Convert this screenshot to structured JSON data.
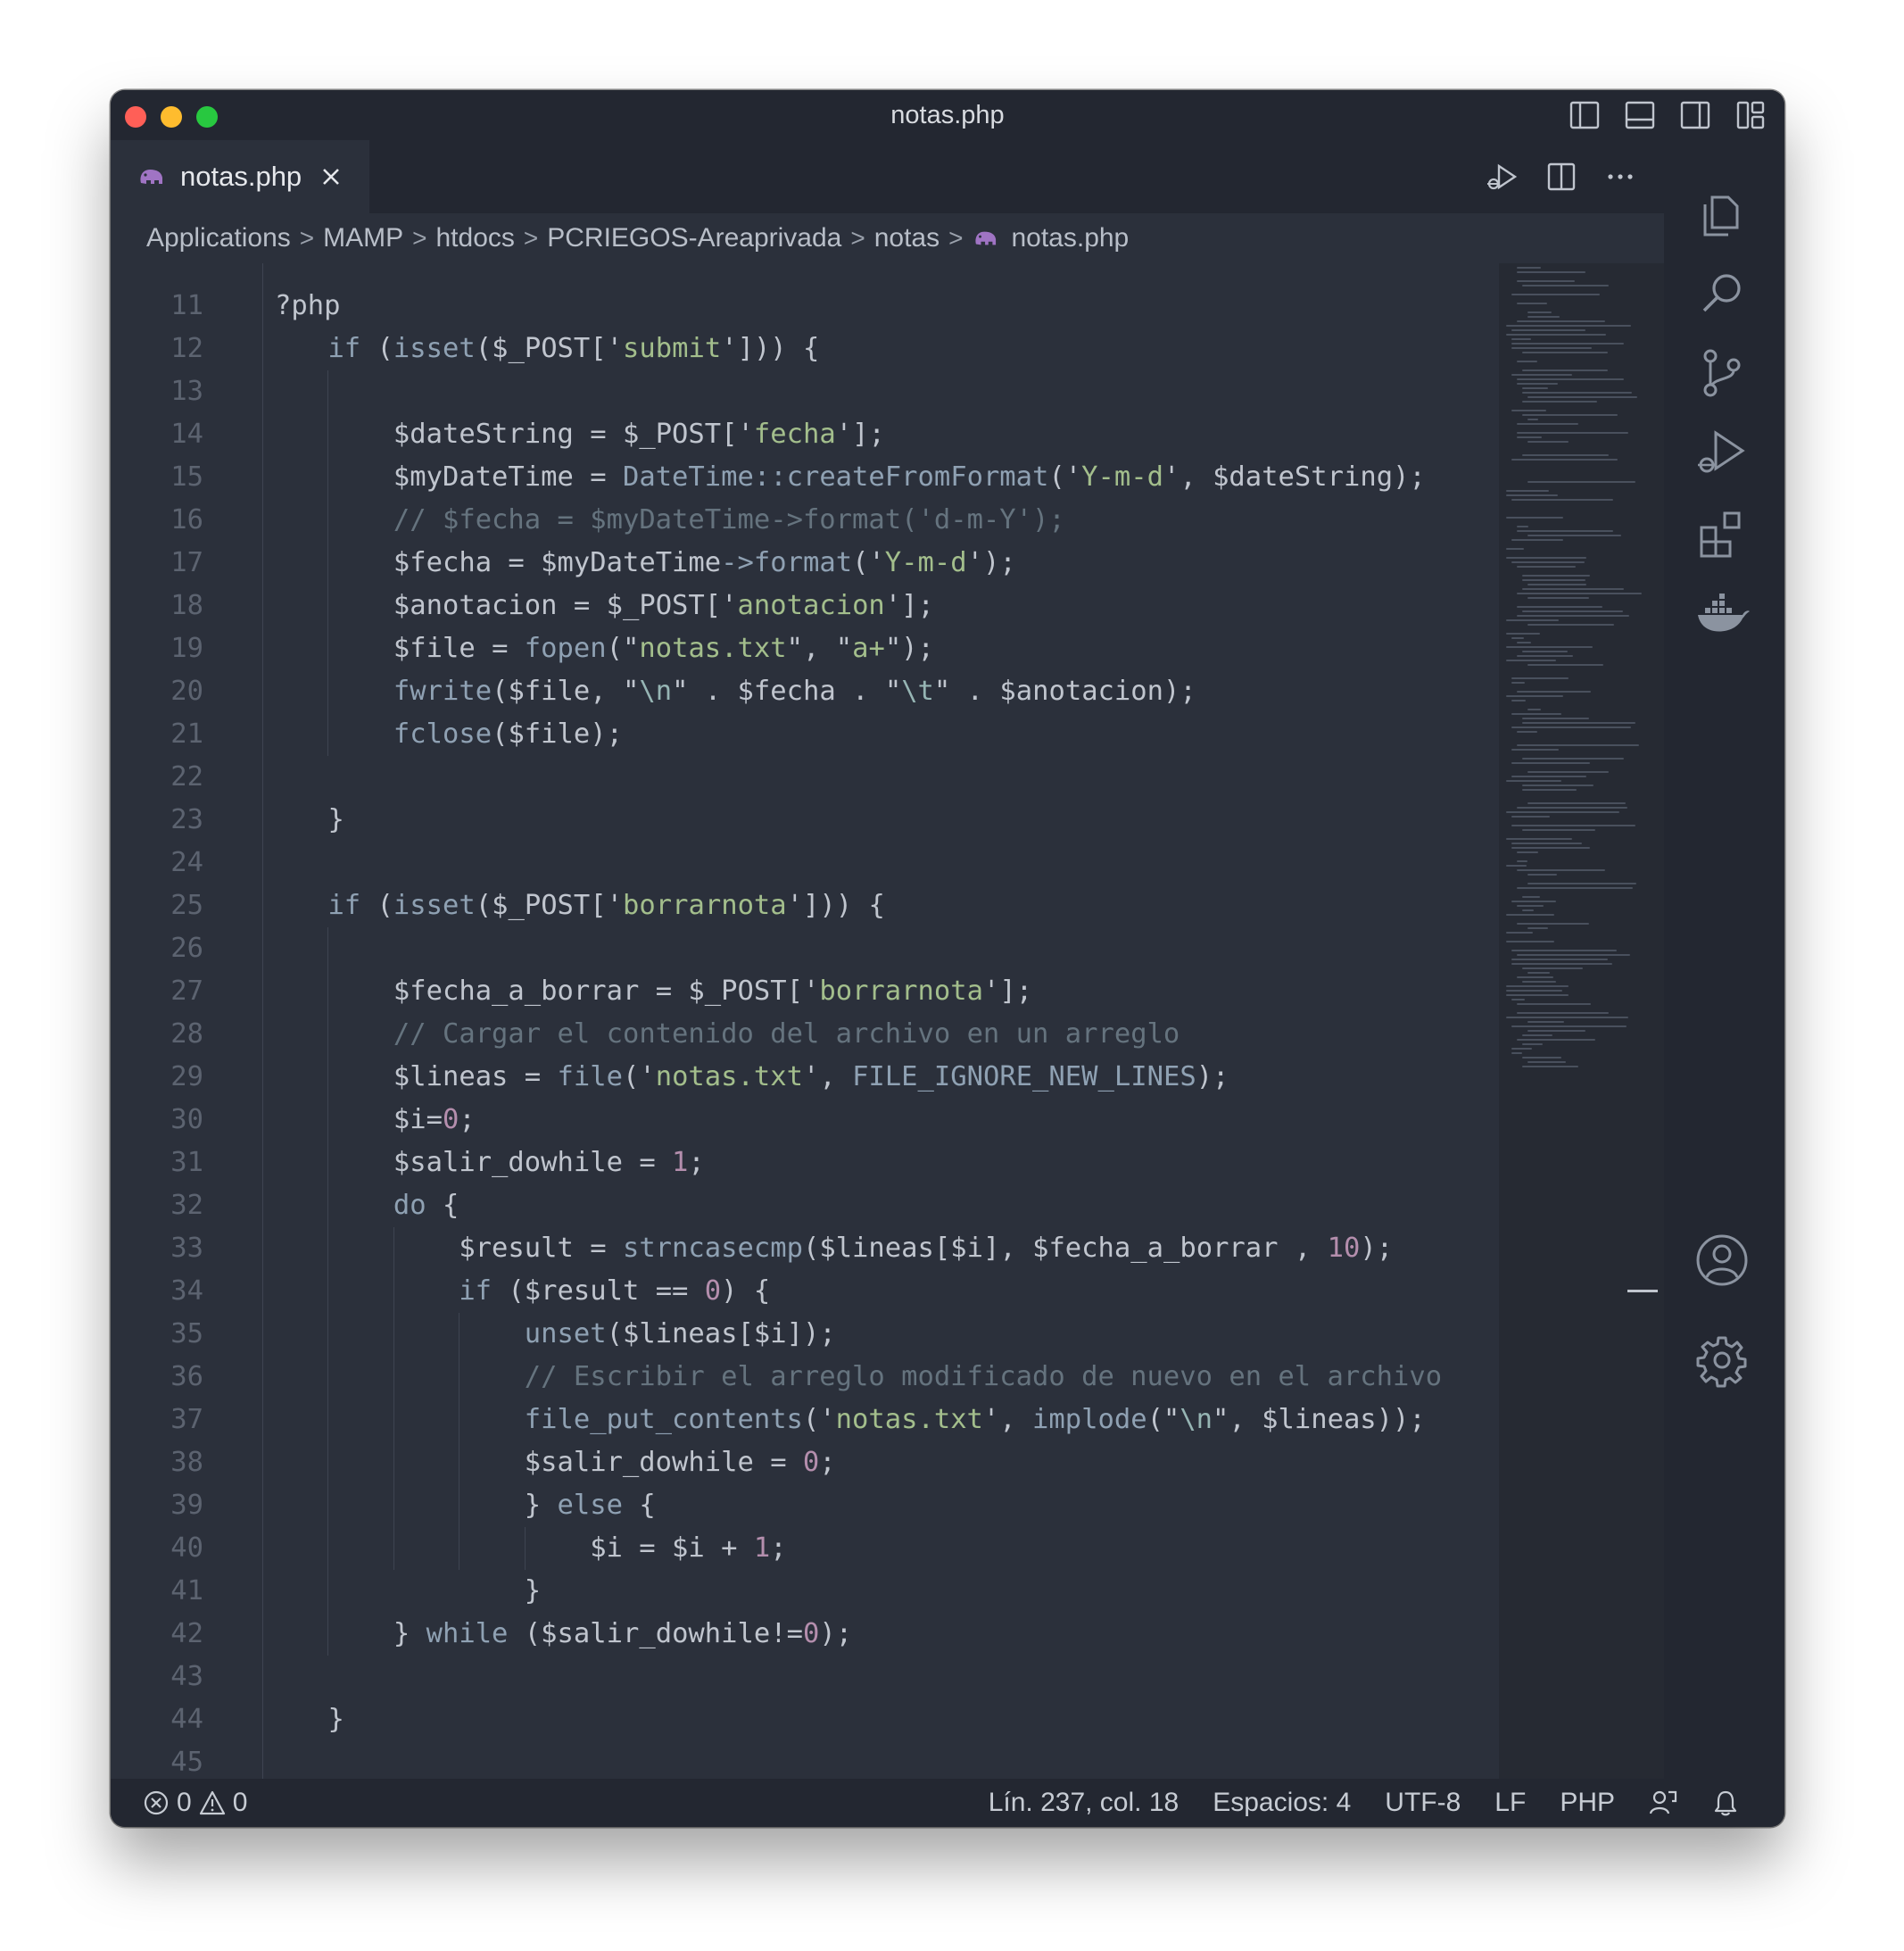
{
  "window": {
    "title": "notas.php"
  },
  "tab": {
    "label": "notas.php"
  },
  "breadcrumb": {
    "items": [
      "Applications",
      "MAMP",
      "htdocs",
      "PCRIEGOS-Areaprivada",
      "notas"
    ],
    "file": "notas.php",
    "separator": ">"
  },
  "editor": {
    "partial_top": "?php",
    "lines": [
      {
        "n": "11",
        "indent": 0,
        "tokens": []
      },
      {
        "n": "12",
        "indent": 1,
        "tokens": [
          [
            "kw",
            "if "
          ],
          [
            "op",
            "("
          ],
          [
            "fn",
            "isset"
          ],
          [
            "op",
            "("
          ],
          [
            "var",
            "$_POST"
          ],
          [
            "op",
            "['"
          ],
          [
            "str",
            "submit"
          ],
          [
            "op",
            "'])) {"
          ]
        ]
      },
      {
        "n": "13",
        "indent": 0,
        "tokens": []
      },
      {
        "n": "14",
        "indent": 2,
        "tokens": [
          [
            "var",
            "$dateString"
          ],
          [
            "op",
            " = "
          ],
          [
            "var",
            "$_POST"
          ],
          [
            "op",
            "['"
          ],
          [
            "str",
            "fecha"
          ],
          [
            "op",
            "'];"
          ]
        ]
      },
      {
        "n": "15",
        "indent": 2,
        "tokens": [
          [
            "var",
            "$myDateTime"
          ],
          [
            "op",
            " = "
          ],
          [
            "fn",
            "DateTime::createFromFormat"
          ],
          [
            "op",
            "('"
          ],
          [
            "str",
            "Y-m-d"
          ],
          [
            "op",
            "', "
          ],
          [
            "var",
            "$dateString"
          ],
          [
            "op",
            ");"
          ]
        ]
      },
      {
        "n": "16",
        "indent": 2,
        "tokens": [
          [
            "cm",
            "// $fecha = $myDateTime->format('d-m-Y');"
          ]
        ]
      },
      {
        "n": "17",
        "indent": 2,
        "tokens": [
          [
            "var",
            "$fecha"
          ],
          [
            "op",
            " = "
          ],
          [
            "var",
            "$myDateTime"
          ],
          [
            "fn",
            "->format"
          ],
          [
            "op",
            "('"
          ],
          [
            "str",
            "Y-m-d"
          ],
          [
            "op",
            "');"
          ]
        ]
      },
      {
        "n": "18",
        "indent": 2,
        "tokens": [
          [
            "var",
            "$anotacion"
          ],
          [
            "op",
            " = "
          ],
          [
            "var",
            "$_POST"
          ],
          [
            "op",
            "['"
          ],
          [
            "str",
            "anotacion"
          ],
          [
            "op",
            "'];"
          ]
        ]
      },
      {
        "n": "19",
        "indent": 2,
        "tokens": [
          [
            "var",
            "$file"
          ],
          [
            "op",
            " = "
          ],
          [
            "fn",
            "fopen"
          ],
          [
            "op",
            "(\""
          ],
          [
            "str",
            "notas.txt"
          ],
          [
            "op",
            "\", \""
          ],
          [
            "str",
            "a+"
          ],
          [
            "op",
            "\");"
          ]
        ]
      },
      {
        "n": "20",
        "indent": 2,
        "tokens": [
          [
            "fn",
            "fwrite"
          ],
          [
            "op",
            "("
          ],
          [
            "var",
            "$file"
          ],
          [
            "op",
            ", \""
          ],
          [
            "esc",
            "\\n"
          ],
          [
            "op",
            "\" . "
          ],
          [
            "var",
            "$fecha"
          ],
          [
            "op",
            " . \""
          ],
          [
            "esc",
            "\\t"
          ],
          [
            "op",
            "\" . "
          ],
          [
            "var",
            "$anotacion"
          ],
          [
            "op",
            ");"
          ]
        ]
      },
      {
        "n": "21",
        "indent": 2,
        "tokens": [
          [
            "fn",
            "fclose"
          ],
          [
            "op",
            "("
          ],
          [
            "var",
            "$file"
          ],
          [
            "op",
            ");"
          ]
        ]
      },
      {
        "n": "22",
        "indent": 0,
        "tokens": []
      },
      {
        "n": "23",
        "indent": 1,
        "tokens": [
          [
            "op",
            "}"
          ]
        ]
      },
      {
        "n": "24",
        "indent": 0,
        "tokens": []
      },
      {
        "n": "25",
        "indent": 1,
        "tokens": [
          [
            "kw",
            "if "
          ],
          [
            "op",
            "("
          ],
          [
            "fn",
            "isset"
          ],
          [
            "op",
            "("
          ],
          [
            "var",
            "$_POST"
          ],
          [
            "op",
            "['"
          ],
          [
            "str",
            "borrarnota"
          ],
          [
            "op",
            "'])) {"
          ]
        ]
      },
      {
        "n": "26",
        "indent": 0,
        "tokens": []
      },
      {
        "n": "27",
        "indent": 2,
        "tokens": [
          [
            "var",
            "$fecha_a_borrar"
          ],
          [
            "op",
            " = "
          ],
          [
            "var",
            "$_POST"
          ],
          [
            "op",
            "['"
          ],
          [
            "str",
            "borrarnota"
          ],
          [
            "op",
            "'];"
          ]
        ]
      },
      {
        "n": "28",
        "indent": 2,
        "tokens": [
          [
            "cm",
            "// Cargar el contenido del archivo en un arreglo"
          ]
        ]
      },
      {
        "n": "29",
        "indent": 2,
        "tokens": [
          [
            "var",
            "$lineas"
          ],
          [
            "op",
            " = "
          ],
          [
            "fn",
            "file"
          ],
          [
            "op",
            "('"
          ],
          [
            "str",
            "notas.txt"
          ],
          [
            "op",
            "', "
          ],
          [
            "const",
            "FILE_IGNORE_NEW_LINES"
          ],
          [
            "op",
            ");"
          ]
        ]
      },
      {
        "n": "30",
        "indent": 2,
        "tokens": [
          [
            "var",
            "$i"
          ],
          [
            "op",
            "="
          ],
          [
            "num",
            "0"
          ],
          [
            "op",
            ";"
          ]
        ]
      },
      {
        "n": "31",
        "indent": 2,
        "tokens": [
          [
            "var",
            "$salir_dowhile"
          ],
          [
            "op",
            " = "
          ],
          [
            "num",
            "1"
          ],
          [
            "op",
            ";"
          ]
        ]
      },
      {
        "n": "32",
        "indent": 2,
        "tokens": [
          [
            "kw",
            "do "
          ],
          [
            "op",
            "{"
          ]
        ]
      },
      {
        "n": "33",
        "indent": 3,
        "tokens": [
          [
            "var",
            "$result"
          ],
          [
            "op",
            " = "
          ],
          [
            "fn",
            "strncasecmp"
          ],
          [
            "op",
            "("
          ],
          [
            "var",
            "$lineas"
          ],
          [
            "op",
            "["
          ],
          [
            "var",
            "$i"
          ],
          [
            "op",
            "], "
          ],
          [
            "var",
            "$fecha_a_borrar"
          ],
          [
            "op",
            " , "
          ],
          [
            "num",
            "10"
          ],
          [
            "op",
            ");"
          ]
        ]
      },
      {
        "n": "34",
        "indent": 3,
        "tokens": [
          [
            "kw",
            "if "
          ],
          [
            "op",
            "("
          ],
          [
            "var",
            "$result"
          ],
          [
            "op",
            " == "
          ],
          [
            "num",
            "0"
          ],
          [
            "op",
            ") {"
          ]
        ]
      },
      {
        "n": "35",
        "indent": 4,
        "tokens": [
          [
            "fn",
            "unset"
          ],
          [
            "op",
            "("
          ],
          [
            "var",
            "$lineas"
          ],
          [
            "op",
            "["
          ],
          [
            "var",
            "$i"
          ],
          [
            "op",
            "]);"
          ]
        ]
      },
      {
        "n": "36",
        "indent": 4,
        "tokens": [
          [
            "cm",
            "// Escribir el arreglo modificado de nuevo en el archivo"
          ]
        ]
      },
      {
        "n": "37",
        "indent": 4,
        "tokens": [
          [
            "fn",
            "file_put_contents"
          ],
          [
            "op",
            "('"
          ],
          [
            "str",
            "notas.txt"
          ],
          [
            "op",
            "', "
          ],
          [
            "fn",
            "implode"
          ],
          [
            "op",
            "(\""
          ],
          [
            "esc",
            "\\n"
          ],
          [
            "op",
            "\", "
          ],
          [
            "var",
            "$lineas"
          ],
          [
            "op",
            "));"
          ]
        ]
      },
      {
        "n": "38",
        "indent": 4,
        "tokens": [
          [
            "var",
            "$salir_dowhile"
          ],
          [
            "op",
            " = "
          ],
          [
            "num",
            "0"
          ],
          [
            "op",
            ";"
          ]
        ]
      },
      {
        "n": "39",
        "indent": 4,
        "tokens": [
          [
            "op",
            "} "
          ],
          [
            "kw",
            "else "
          ],
          [
            "op",
            "{"
          ]
        ]
      },
      {
        "n": "40",
        "indent": 5,
        "tokens": [
          [
            "var",
            "$i"
          ],
          [
            "op",
            " = "
          ],
          [
            "var",
            "$i"
          ],
          [
            "op",
            " + "
          ],
          [
            "num",
            "1"
          ],
          [
            "op",
            ";"
          ]
        ]
      },
      {
        "n": "41",
        "indent": 4,
        "tokens": [
          [
            "op",
            "}"
          ]
        ]
      },
      {
        "n": "42",
        "indent": 2,
        "tokens": [
          [
            "op",
            "} "
          ],
          [
            "kw",
            "while "
          ],
          [
            "op",
            "("
          ],
          [
            "var",
            "$salir_dowhile"
          ],
          [
            "op",
            "!="
          ],
          [
            "num",
            "0"
          ],
          [
            "op",
            ");"
          ]
        ]
      },
      {
        "n": "43",
        "indent": 0,
        "tokens": []
      },
      {
        "n": "44",
        "indent": 1,
        "tokens": [
          [
            "op",
            "}"
          ]
        ]
      },
      {
        "n": "45",
        "indent": 0,
        "tokens": []
      }
    ]
  },
  "statusbar": {
    "errors": "0",
    "warnings": "0",
    "position": "Lín. 237, col. 18",
    "spaces": "Espacios: 4",
    "encoding": "UTF-8",
    "eol": "LF",
    "language": "PHP"
  },
  "colors": {
    "editor_bg": "#2b303b",
    "chrome_bg": "#232731",
    "php_icon": "#a074c4"
  }
}
